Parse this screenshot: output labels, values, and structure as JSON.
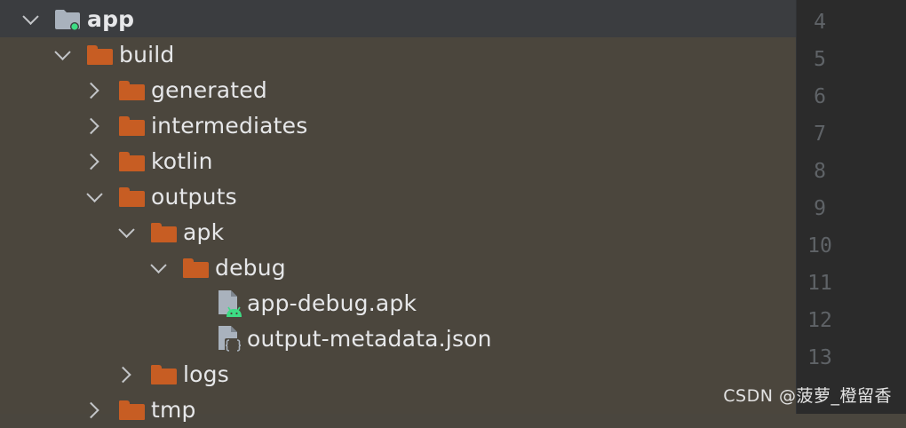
{
  "colors": {
    "pane_bg": "#4b463d",
    "header_bg": "#3b3d40",
    "gutter_bg": "#2b2b2b",
    "folder_orange": "#c75d23",
    "module_folder": "#a9b2bd",
    "module_dot": "#3ddc84",
    "android_green": "#3ddc84",
    "text": "#e6e7e9",
    "line_number": "#5f6367"
  },
  "tree": [
    {
      "label": "app",
      "icon": "module-folder-icon",
      "expanded": true,
      "bold": true
    },
    {
      "label": "build",
      "icon": "folder-icon",
      "expanded": true
    },
    {
      "label": "generated",
      "icon": "folder-icon",
      "expanded": false
    },
    {
      "label": "intermediates",
      "icon": "folder-icon",
      "expanded": false
    },
    {
      "label": "kotlin",
      "icon": "folder-icon",
      "expanded": false
    },
    {
      "label": "outputs",
      "icon": "folder-icon",
      "expanded": true
    },
    {
      "label": "apk",
      "icon": "folder-icon",
      "expanded": true
    },
    {
      "label": "debug",
      "icon": "folder-icon",
      "expanded": true
    },
    {
      "label": "app-debug.apk",
      "icon": "android-apk-file-icon"
    },
    {
      "label": "output-metadata.json",
      "icon": "json-file-icon"
    },
    {
      "label": "logs",
      "icon": "folder-icon",
      "expanded": false
    },
    {
      "label": "tmp",
      "icon": "folder-icon",
      "expanded": false
    }
  ],
  "gutter": {
    "line_numbers": [
      "4",
      "5",
      "6",
      "7",
      "8",
      "9",
      "10",
      "11",
      "12",
      "13"
    ]
  },
  "watermark": "CSDN @菠萝_橙留香"
}
